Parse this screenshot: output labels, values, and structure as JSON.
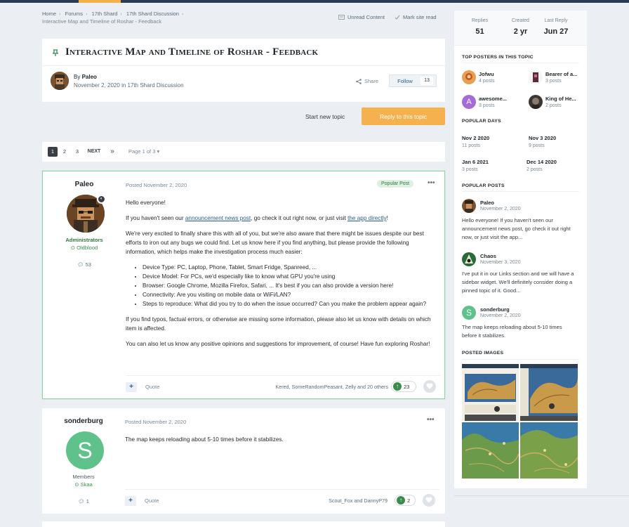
{
  "breadcrumb": {
    "items": [
      "Home",
      "Forums",
      "17th Shard",
      "17th Shard Discussion"
    ],
    "current": "Interactive Map and Timeline of Roshar - Feedback"
  },
  "top_links": {
    "unread": "Unread Content",
    "mark_read": "Mark site read"
  },
  "topic": {
    "title": "Interactive Map and Timeline of Roshar - Feedback",
    "by_label": "By",
    "author": "Paleo",
    "date": "November 2, 2020",
    "in_label": "in",
    "forum": "17th Shard Discussion",
    "share": "Share",
    "follow": "Follow",
    "follow_count": "13"
  },
  "actions": {
    "start_new": "Start new topic",
    "reply": "Reply to this topic"
  },
  "pagination": {
    "pages": [
      "1",
      "2",
      "3"
    ],
    "next": "NEXT",
    "last": "»",
    "page_of": "Page 1 of 3"
  },
  "posts": [
    {
      "author": "Paleo",
      "group": "Administrators",
      "rank": "Oldblood",
      "post_count": "53",
      "posted": "Posted November 2, 2020",
      "badge": "Popular Post",
      "content": {
        "p1": "Hello everyone!",
        "p2_a": "If you haven't seen our ",
        "p2_link1": "announcement news post",
        "p2_b": ", go check it out right now, or just visit ",
        "p2_link2": "the app directly",
        "p2_c": "!",
        "p3": "We're very excited to finally share this with all of you, but we're also aware that there might be issues despite our best efforts to iron out any bugs we could find. Let us know here if you find anything, but please provide the following information, which helps make the investigation process much easier:",
        "list": [
          "Device Type: PC, Laptop, Phone, Tablet, Smart Fridge, Spanreed, ...",
          "Device Model: For PCs, we'd especially like to know what GPU you're using",
          "Browser: Google Chrome, Mozilla Firefox, Safari, ... It's best if you can also provide a version here!",
          "Connectivity: Are you visiting on mobile data or WiFi/LAN?",
          "Steps to reproduce: What did you try to do when the issue occurred? Can you make the problem appear again?"
        ],
        "p4": "If you find typos, factual errors, or otherwise are missing some information, please also let us know with details on which item is affected.",
        "p5": "You can also let us know any positive opinions and suggestions for improvement, of course! Have fun exploring Roshar!"
      },
      "quote": "Quote",
      "likers": "Kered, SomeRandomPeasant, Zelly and 20 others",
      "reputation": "23"
    },
    {
      "author": "sonderburg",
      "avatar_letter": "S",
      "group": "Members",
      "rank": "Skaa",
      "post_count": "1",
      "posted": "Posted November 2, 2020",
      "content": "The map keeps reloading about 5-10 times before it stabilizes.",
      "quote": "Quote",
      "likers": "Scout_Fox and DannyP79",
      "reputation": "2"
    }
  ],
  "sidebar": {
    "stats": [
      {
        "label": "Replies",
        "value": "51"
      },
      {
        "label": "Created",
        "value": "2 yr"
      },
      {
        "label": "Last Reply",
        "value": "Jun 27"
      }
    ],
    "top_posters_title": "TOP POSTERS IN THIS TOPIC",
    "top_posters": [
      {
        "name": "Jofwu",
        "posts": "4 posts"
      },
      {
        "name": "Bearer of a...",
        "posts": "3 posts"
      },
      {
        "name": "awesome...",
        "posts": "3 posts",
        "letter": "A"
      },
      {
        "name": "King of He...",
        "posts": "2 posts"
      }
    ],
    "popular_days_title": "POPULAR DAYS",
    "popular_days": [
      {
        "date": "Nov 2 2020",
        "count": "11 posts"
      },
      {
        "date": "Nov 3 2020",
        "count": "9 posts"
      },
      {
        "date": "Jan 6 2021",
        "count": "3 posts"
      },
      {
        "date": "Dec 14 2020",
        "count": "2 posts"
      }
    ],
    "popular_posts_title": "POPULAR POSTS",
    "popular_posts": [
      {
        "name": "Paleo",
        "date": "November 2, 2020",
        "text": "Hello everyone! If you haven't seen our announcement news post, go check it out right now, or just visit the app..."
      },
      {
        "name": "Chaos",
        "date": "November 3, 2020",
        "text": "I've put it in our Links section and we will have a sidebar widget. We'll definitely consider doing a pinned topic of it. Good..."
      },
      {
        "name": "sonderburg",
        "date": "November 2, 2020",
        "text": "The map keeps reloading about 5-10 times before it stabilizes.",
        "letter": "S"
      }
    ],
    "posted_images_title": "POSTED IMAGES"
  },
  "colors": {
    "accent": "#f5b14e",
    "green": "#3d8b4a",
    "link": "#2b5d8a",
    "highlight_border": "#8fd1a8"
  }
}
